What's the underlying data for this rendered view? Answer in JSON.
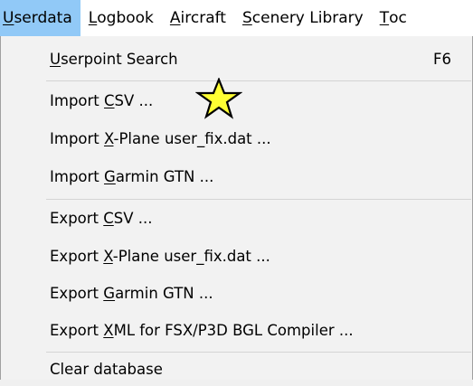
{
  "menubar": {
    "items": [
      {
        "mnemonic": "U",
        "rest": "serdata"
      },
      {
        "mnemonic": "L",
        "rest": "ogbook"
      },
      {
        "mnemonic": "A",
        "rest": "ircraft"
      },
      {
        "mnemonic": "S",
        "rest": "cenery Library"
      },
      {
        "mnemonic": "T",
        "rest": "oc"
      }
    ],
    "active_index": 0,
    "active_color": "#91c9f7"
  },
  "menu": {
    "items": [
      {
        "pre": "",
        "mnemonic": "U",
        "post": "serpoint Search",
        "shortcut": "F6"
      },
      {
        "pre": "Import ",
        "mnemonic": "C",
        "post": "SV ..."
      },
      {
        "pre": "Import ",
        "mnemonic": "X",
        "post": "-Plane user_fix.dat ..."
      },
      {
        "pre": "Import ",
        "mnemonic": "G",
        "post": "armin GTN ..."
      },
      {
        "pre": "Export ",
        "mnemonic": "C",
        "post": "SV ..."
      },
      {
        "pre": "Export ",
        "mnemonic": "X",
        "post": "-Plane user_fix.dat ..."
      },
      {
        "pre": "Export ",
        "mnemonic": "G",
        "post": "armin GTN ..."
      },
      {
        "pre": "Export ",
        "mnemonic": "X",
        "post": "ML for FSX/P3D BGL Compiler ..."
      },
      {
        "pre": "Clear database",
        "mnemonic": "",
        "post": ""
      }
    ]
  },
  "overlay": {
    "star_icon": "star-icon",
    "star_fill": "#ffff33",
    "star_stroke": "#000000"
  }
}
